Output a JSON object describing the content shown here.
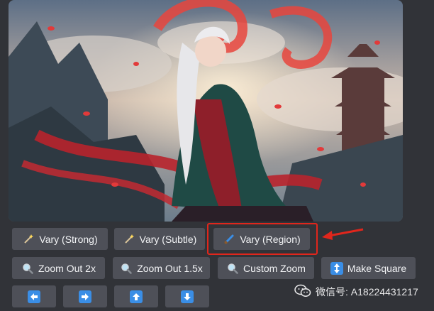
{
  "buttons": {
    "vary_strong": "Vary (Strong)",
    "vary_subtle": "Vary (Subtle)",
    "vary_region": "Vary (Region)",
    "zoom_out_2x": "Zoom Out 2x",
    "zoom_out_15x": "Zoom Out 1.5x",
    "custom_zoom": "Custom Zoom",
    "make_square": "Make Square"
  },
  "icons": {
    "vary_strong": "magic-wand-icon",
    "vary_subtle": "magic-wand-icon",
    "vary_region": "paintbrush-icon",
    "zoom": "magnifier-icon",
    "make_square": "up-down-arrow-icon",
    "pan": [
      "arrow-left-icon",
      "arrow-right-icon",
      "arrow-up-icon",
      "arrow-down-icon"
    ]
  },
  "watermark": {
    "text": "微信号: A18224431217"
  },
  "colors": {
    "background": "#313338",
    "button": "#4e5058",
    "highlight": "#e0261c",
    "arrow_icon_bg": "#3a8ee6"
  }
}
